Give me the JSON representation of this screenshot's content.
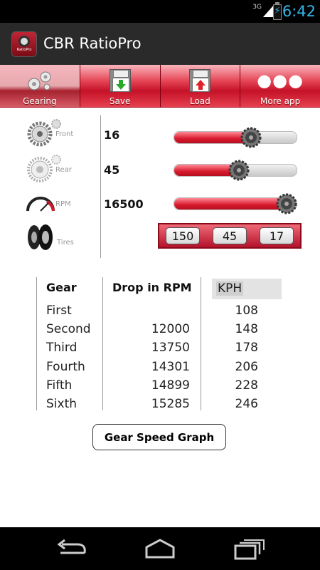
{
  "status": {
    "network": "3G",
    "time": "6:42"
  },
  "app": {
    "title": "CBR RatioPro",
    "icon_label": "RatioPro"
  },
  "toolbar": {
    "items": [
      {
        "label": "Gearing",
        "icon": "gears-icon",
        "active": true
      },
      {
        "label": "Save",
        "icon": "save-icon"
      },
      {
        "label": "Load",
        "icon": "load-icon"
      },
      {
        "label": "More app",
        "icon": "more-icon"
      }
    ]
  },
  "controls": {
    "front": {
      "label": "Front",
      "value": "16",
      "slider_fraction": 0.63
    },
    "rear": {
      "label": "Rear",
      "value": "45",
      "slider_fraction": 0.53
    },
    "rpm": {
      "label": "RPM",
      "value": "16500",
      "slider_fraction": 0.92
    },
    "tires": {
      "label": "Tires",
      "width": "150",
      "aspect": "45",
      "rim": "17"
    }
  },
  "table": {
    "headers": {
      "gear": "Gear",
      "drop": "Drop in RPM",
      "unit": "KPH"
    },
    "rows": [
      {
        "gear": "First",
        "drop": "",
        "speed": "108"
      },
      {
        "gear": "Second",
        "drop": "12000",
        "speed": "148"
      },
      {
        "gear": "Third",
        "drop": "13750",
        "speed": "178"
      },
      {
        "gear": "Fourth",
        "drop": "14301",
        "speed": "206"
      },
      {
        "gear": "Fifth",
        "drop": "14899",
        "speed": "228"
      },
      {
        "gear": "Sixth",
        "drop": "15285",
        "speed": "246"
      }
    ]
  },
  "graph_button": "Gear Speed Graph",
  "colors": {
    "accent": "#d81a2d",
    "status_blue": "#35b5e5"
  }
}
